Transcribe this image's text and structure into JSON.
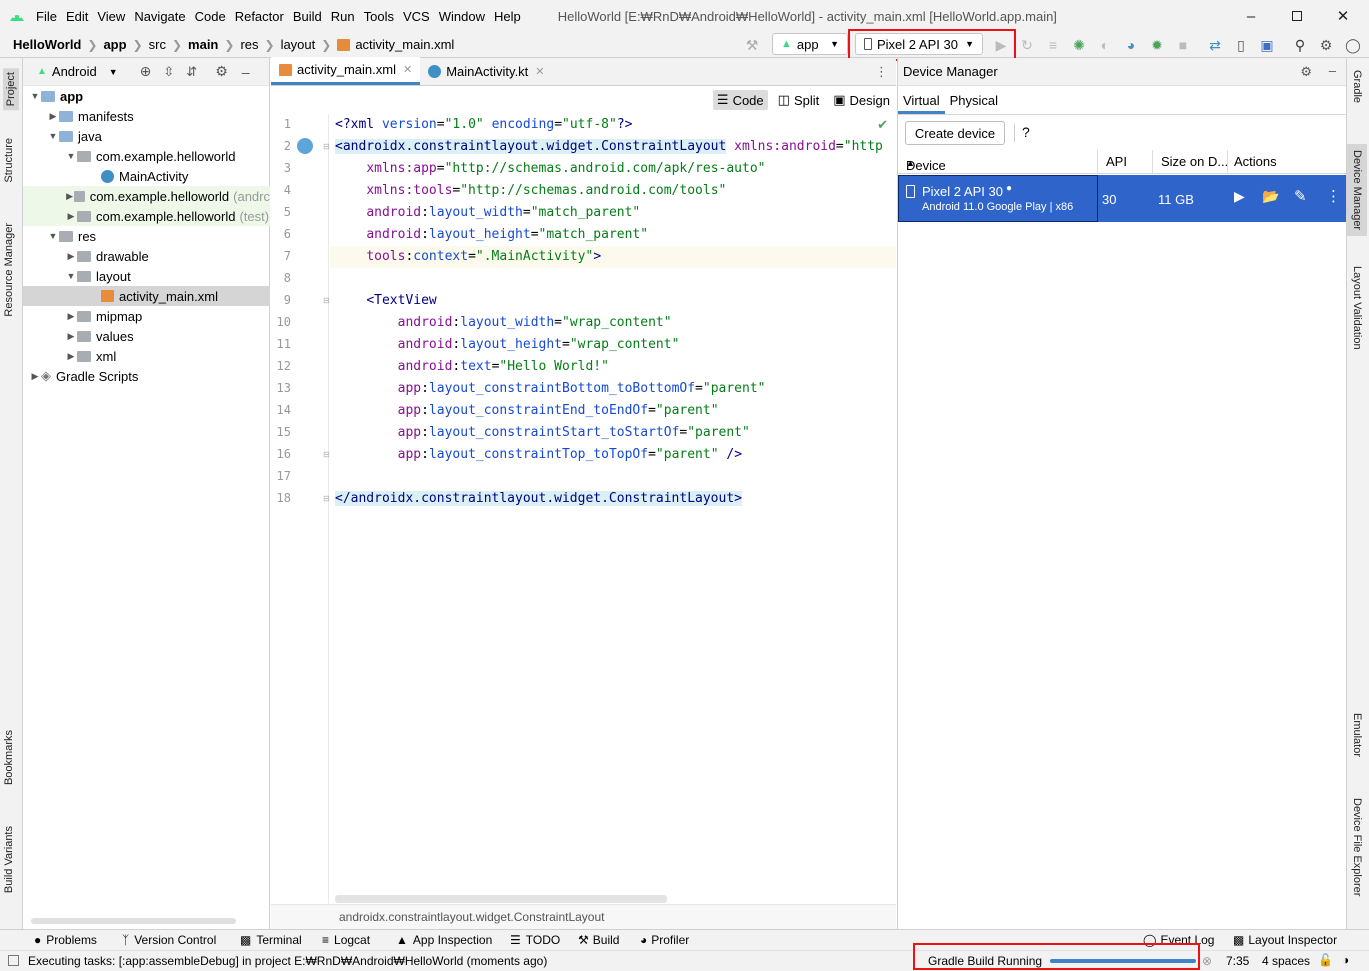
{
  "window": {
    "title": "HelloWorld [E:₩RnD₩Android₩HelloWorld] - activity_main.xml [HelloWorld.app.main]",
    "menu": [
      "File",
      "Edit",
      "View",
      "Navigate",
      "Code",
      "Refactor",
      "Build",
      "Run",
      "Tools",
      "VCS",
      "Window",
      "Help"
    ]
  },
  "breadcrumb": [
    "HelloWorld",
    "app",
    "src",
    "main",
    "res",
    "layout",
    "activity_main.xml"
  ],
  "toolbar": {
    "run_config": "app",
    "device": "Pixel 2 API 30"
  },
  "left_strip": [
    "Project",
    "Structure",
    "Resource Manager",
    "Bookmarks",
    "Build Variants"
  ],
  "right_strip": [
    "Gradle",
    "Device Manager",
    "Layout Validation",
    "Emulator",
    "Device File Explorer"
  ],
  "project": {
    "view": "Android",
    "tree": [
      {
        "label": "app",
        "bold": true
      },
      {
        "label": "manifests"
      },
      {
        "label": "java"
      },
      {
        "label": "com.example.helloworld"
      },
      {
        "label": "MainActivity"
      },
      {
        "label": "com.example.helloworld",
        "suffix": "(andrc"
      },
      {
        "label": "com.example.helloworld",
        "suffix": "(test)"
      },
      {
        "label": "res"
      },
      {
        "label": "drawable"
      },
      {
        "label": "layout"
      },
      {
        "label": "activity_main.xml"
      },
      {
        "label": "mipmap"
      },
      {
        "label": "values"
      },
      {
        "label": "xml"
      },
      {
        "label": "Gradle Scripts"
      }
    ]
  },
  "editor": {
    "tabs": [
      "activity_main.xml",
      "MainActivity.kt"
    ],
    "view_modes": [
      "Code",
      "Split",
      "Design"
    ],
    "footer": "androidx.constraintlayout.widget.ConstraintLayout",
    "line_numbers": [
      "1",
      "2",
      "3",
      "4",
      "5",
      "6",
      "7",
      "8",
      "9",
      "10",
      "11",
      "12",
      "13",
      "14",
      "15",
      "16",
      "17",
      "18"
    ]
  },
  "device_manager": {
    "title": "Device Manager",
    "tabs": [
      "Virtual",
      "Physical"
    ],
    "create_label": "Create device",
    "help": "?",
    "columns": [
      "Device",
      "API",
      "Size on D...",
      "Actions"
    ],
    "device": {
      "name": "Pixel 2 API 30",
      "detail": "Android 11.0 Google Play | x86",
      "api": "30",
      "size": "11 GB"
    }
  },
  "bottom_tabs": [
    "Problems",
    "Version Control",
    "Terminal",
    "Logcat",
    "App Inspection",
    "TODO",
    "Build",
    "Profiler"
  ],
  "bottom_right_tabs": [
    "Event Log",
    "Layout Inspector"
  ],
  "status": {
    "message": "Executing tasks: [:app:assembleDebug] in project E:₩RnD₩Android₩HelloWorld (moments ago)",
    "gradle": "Gradle Build Running",
    "position": "7:35",
    "indent": "4 spaces"
  },
  "colors": {
    "accent": "#4083c9",
    "selection": "#2f65ca",
    "highlight_box": "#e11111"
  }
}
